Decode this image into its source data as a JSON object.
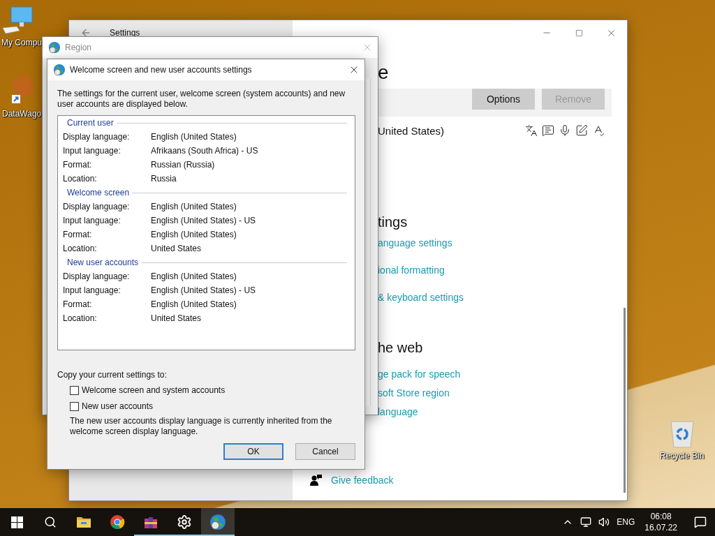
{
  "desktop": {
    "icons": [
      {
        "kind": "computer",
        "label": "My Compu"
      },
      {
        "kind": "shortcut",
        "label": "DataWago"
      },
      {
        "kind": "recycle",
        "label": "Recycle Bin"
      }
    ]
  },
  "settings_window": {
    "title": "Settings",
    "heading": "e",
    "buttons": [
      {
        "label": "Options",
        "disabled": false
      },
      {
        "label": "Remove",
        "disabled": true
      }
    ],
    "language_item": "United States)",
    "sections": [
      {
        "heading": "tings",
        "links": [
          "anguage settings",
          "ional formatting",
          "& keyboard settings"
        ]
      },
      {
        "heading": "he web",
        "links": [
          "ge pack for speech",
          "soft Store region",
          "language"
        ]
      }
    ],
    "feedback_link": "Give feedback"
  },
  "region_window": {
    "title": "Region"
  },
  "dialog": {
    "title": "Welcome screen and new user accounts settings",
    "intro": "The settings for the current user, welcome screen (system accounts) and new user accounts are displayed below.",
    "groups": [
      {
        "heading": "Current user",
        "rows": [
          {
            "label": "Display language:",
            "value": "English (United States)"
          },
          {
            "label": "Input language:",
            "value": "Afrikaans (South Africa) - US"
          },
          {
            "label": "Format:",
            "value": "Russian (Russia)"
          },
          {
            "label": "Location:",
            "value": "Russia"
          }
        ]
      },
      {
        "heading": "Welcome screen",
        "rows": [
          {
            "label": "Display language:",
            "value": "English (United States)"
          },
          {
            "label": "Input language:",
            "value": "English (United States) - US"
          },
          {
            "label": "Format:",
            "value": "English (United States)"
          },
          {
            "label": "Location:",
            "value": "United States"
          }
        ]
      },
      {
        "heading": "New user accounts",
        "rows": [
          {
            "label": "Display language:",
            "value": "English (United States)"
          },
          {
            "label": "Input language:",
            "value": "English (United States) - US"
          },
          {
            "label": "Format:",
            "value": "English (United States)"
          },
          {
            "label": "Location:",
            "value": "United States"
          }
        ]
      }
    ],
    "copy_label": "Copy your current settings to:",
    "checkboxes": [
      {
        "label": "Welcome screen and system accounts",
        "checked": false
      },
      {
        "label": "New user accounts",
        "checked": false
      }
    ],
    "note": "The new user accounts display language is currently inherited from the welcome screen display language.",
    "buttons": [
      {
        "label": "OK",
        "default": true
      },
      {
        "label": "Cancel",
        "default": false
      }
    ]
  },
  "taskbar": {
    "apps": [
      {
        "kind": "explorer",
        "running": false,
        "selected": false
      },
      {
        "kind": "browser",
        "running": false,
        "selected": false
      },
      {
        "kind": "archive",
        "running": true,
        "selected": false
      },
      {
        "kind": "settings",
        "running": true,
        "selected": false
      },
      {
        "kind": "region",
        "running": true,
        "selected": true
      }
    ],
    "language": "ENG",
    "time": "06:08",
    "date": "16.07.22"
  }
}
